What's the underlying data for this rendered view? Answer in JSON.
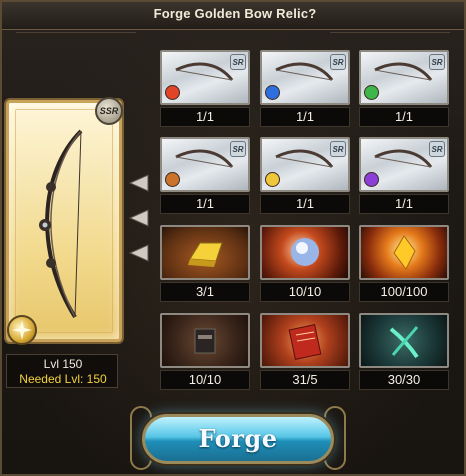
{
  "dialog": {
    "title": "Forge Golden Bow Relic?"
  },
  "relic": {
    "rarity": "SSR",
    "element": "light",
    "level_label": "Lvl 150",
    "needed_level_label": "Needed Lvl: 150"
  },
  "materials": [
    {
      "name": "bow-fire",
      "count": "1/1",
      "tag": "SR",
      "gem": "#e0452a"
    },
    {
      "name": "bow-water",
      "count": "1/1",
      "tag": "SR",
      "gem": "#2e6fe0"
    },
    {
      "name": "bow-wind",
      "count": "1/1",
      "tag": "SR",
      "gem": "#3fb64a"
    },
    {
      "name": "bow-earth",
      "count": "1/1",
      "tag": "SR",
      "gem": "#c9742a"
    },
    {
      "name": "bow-light",
      "count": "1/1",
      "tag": "SR",
      "gem": "#f0c63a"
    },
    {
      "name": "bow-dark",
      "count": "1/1",
      "tag": "SR",
      "gem": "#8b3fd8"
    },
    {
      "name": "gold-ingot",
      "count": "3/1"
    },
    {
      "name": "sphere-orb",
      "count": "10/10"
    },
    {
      "name": "golden-shard",
      "count": "100/100"
    },
    {
      "name": "dark-chest",
      "count": "10/10"
    },
    {
      "name": "red-scroll",
      "count": "31/5"
    },
    {
      "name": "green-horn",
      "count": "30/30"
    }
  ],
  "forge_button": {
    "label": "Forge"
  },
  "colors": {
    "accent_gold": "#c9a35a",
    "needed_level": "#f4d23c",
    "forge_blue": "#57c6e6"
  }
}
